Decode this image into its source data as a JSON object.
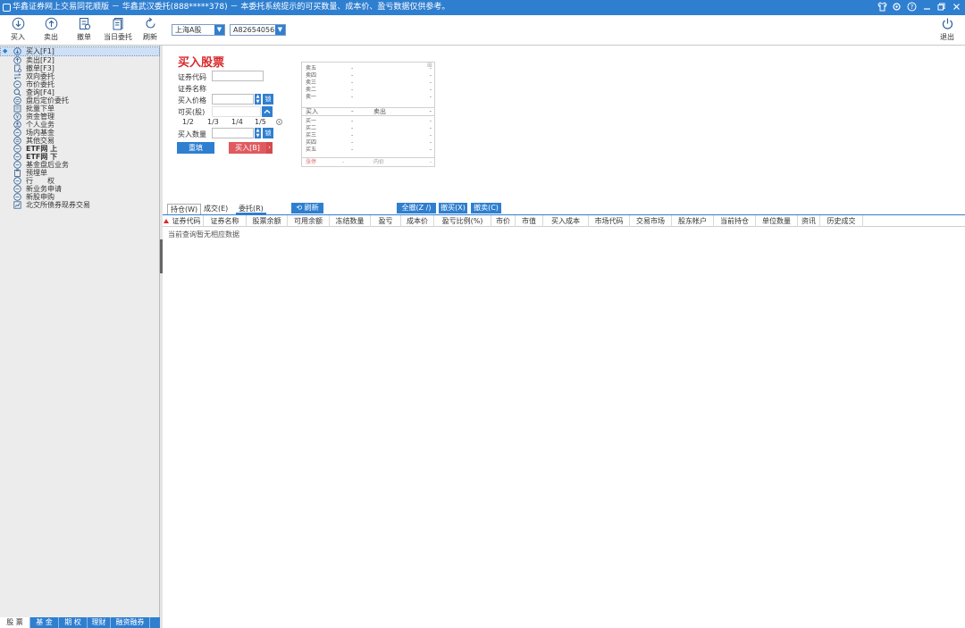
{
  "window": {
    "title": "华鑫证券网上交易同花顺版 － 华鑫武汉委托(888*****378) － 本委托系统提示的可买数量、成本价、盈亏数据仅供参考。",
    "controls": [
      "shirt-icon",
      "gear-icon",
      "help-icon",
      "minimize-icon",
      "restore-icon",
      "close-icon"
    ]
  },
  "toolbar": {
    "buttons": [
      {
        "label": "买入",
        "icon": "buy-icon"
      },
      {
        "label": "卖出",
        "icon": "sell-icon"
      },
      {
        "label": "撤单",
        "icon": "cancel-order-icon"
      },
      {
        "label": "当日委托",
        "icon": "today-orders-icon"
      },
      {
        "label": "刷新",
        "icon": "refresh-icon"
      }
    ],
    "market": "上海A股",
    "account": "A826540568",
    "exit_label": "退出"
  },
  "sidebar": {
    "items": [
      {
        "label": "买入[F1]",
        "active": true
      },
      {
        "label": "卖出[F2]"
      },
      {
        "label": "撤单[F3]"
      },
      {
        "label": "双向委托"
      },
      {
        "label": "市价委托"
      },
      {
        "label": "查询[F4]"
      },
      {
        "label": "盘后定价委托"
      },
      {
        "label": "批量下单"
      },
      {
        "label": "资金管理"
      },
      {
        "label": "个人业务"
      },
      {
        "label": "场内基金"
      },
      {
        "label": "其他交易"
      },
      {
        "label": "ETF网 上"
      },
      {
        "label": "ETF网 下"
      },
      {
        "label": "基金盘后业务"
      },
      {
        "label": "预埋单"
      },
      {
        "label": "行　　权"
      },
      {
        "label": "新业务申请"
      },
      {
        "label": "新股申购"
      },
      {
        "label": "北交所债券现券交易"
      }
    ],
    "tabs": [
      "股 票",
      "基 金",
      "期 权",
      "理财",
      "融资融券"
    ]
  },
  "order": {
    "heading": "买入股票",
    "code_label": "证券代码",
    "name_label": "证券名称",
    "price_label": "买入价格",
    "avail_label": "可买(股)",
    "qty_label": "买入数量",
    "lock_label": "锁",
    "fractions": [
      "1/2",
      "1/3",
      "1/4",
      "1/5"
    ],
    "reset_label": "重填",
    "buy_label": "买入[B]"
  },
  "quote": {
    "sell_levels": [
      "卖五",
      "卖四",
      "卖三",
      "卖二",
      "卖一"
    ],
    "buy_levels": [
      "买一",
      "买二",
      "买三",
      "买四",
      "买五"
    ],
    "dash": "-",
    "buy_label": "买入",
    "sell_label": "卖出",
    "limit_up": "涨停",
    "inner": "内价",
    "mid_dash": "-"
  },
  "positions": {
    "tabs": [
      "持仓(W)",
      "成交(E)",
      "委托(R)"
    ],
    "refresh_label": "刷新",
    "all_label": "全撤(Z /)",
    "cancel_buy_label": "撤买(X)",
    "cancel_sell_label": "撤卖(C)",
    "columns": [
      "证券代码",
      "证券名称",
      "股票余额",
      "可用余额",
      "冻结数量",
      "盈亏",
      "成本价",
      "盈亏比例(%)",
      "市价",
      "市值",
      "买入成本",
      "市场代码",
      "交易市场",
      "股东帐户",
      "当前持仓",
      "单位数量",
      "资讯",
      "历史成交"
    ],
    "empty_message": "当前查询暂无相应数据"
  }
}
